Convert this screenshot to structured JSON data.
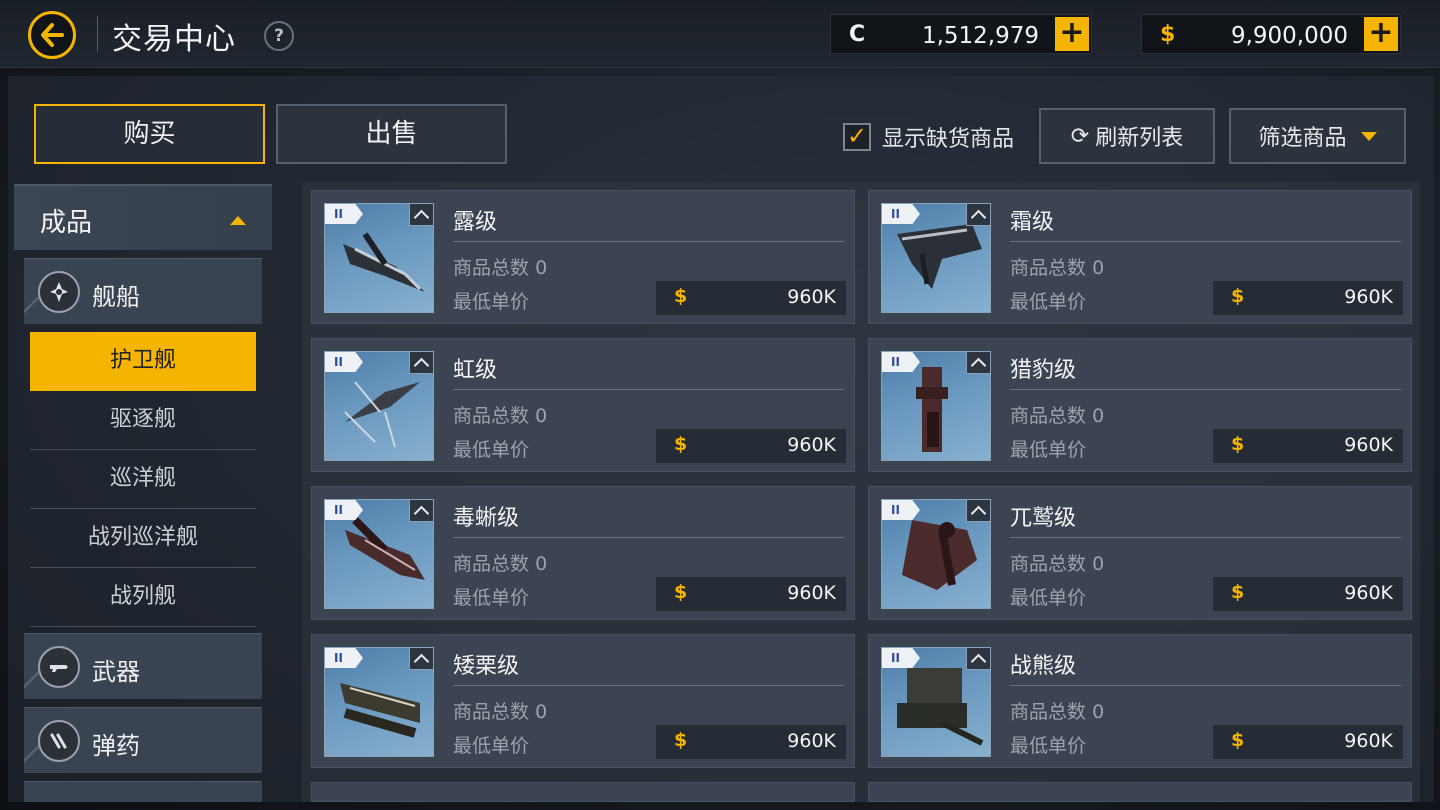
{
  "header": {
    "title": "交易中心",
    "help": "?",
    "credits": {
      "symbol": "C",
      "amount": "1,512,979",
      "plus": "+"
    },
    "cash": {
      "symbol": "$",
      "amount": "9,900,000",
      "plus": "+"
    }
  },
  "colors": {
    "accent": "#f5b400",
    "panel": "#3b4450",
    "thumb_bg": "#6a98bf"
  },
  "tabs": {
    "buy": "购买",
    "sell": "出售"
  },
  "toolbar": {
    "show_out_of_stock": "显示缺货商品",
    "show_out_of_stock_checked": true,
    "refresh": "刷新列表",
    "filter": "筛选商品"
  },
  "sidebar": {
    "header": "成品",
    "categories": [
      {
        "label": "舰船",
        "icon": "ship-icon"
      },
      {
        "label": "武器",
        "icon": "weapon-icon"
      },
      {
        "label": "弹药",
        "icon": "ammo-icon"
      }
    ],
    "ship_types": [
      "护卫舰",
      "驱逐舰",
      "巡洋舰",
      "战列巡洋舰",
      "战列舰"
    ],
    "active_ship_type": "护卫舰"
  },
  "labels": {
    "total": "商品总数",
    "min_price": "最低单价",
    "currency_symbol": "$"
  },
  "items": [
    {
      "name": "露级",
      "total": "0",
      "price": "960K",
      "tier": "II"
    },
    {
      "name": "霜级",
      "total": "0",
      "price": "960K",
      "tier": "II"
    },
    {
      "name": "虹级",
      "total": "0",
      "price": "960K",
      "tier": "II"
    },
    {
      "name": "猎豹级",
      "total": "0",
      "price": "960K",
      "tier": "II"
    },
    {
      "name": "毒蜥级",
      "total": "0",
      "price": "960K",
      "tier": "II"
    },
    {
      "name": "兀鹫级",
      "total": "0",
      "price": "960K",
      "tier": "II"
    },
    {
      "name": "矮栗级",
      "total": "0",
      "price": "960K",
      "tier": "II"
    },
    {
      "name": "战熊级",
      "total": "0",
      "price": "960K",
      "tier": "II"
    }
  ]
}
